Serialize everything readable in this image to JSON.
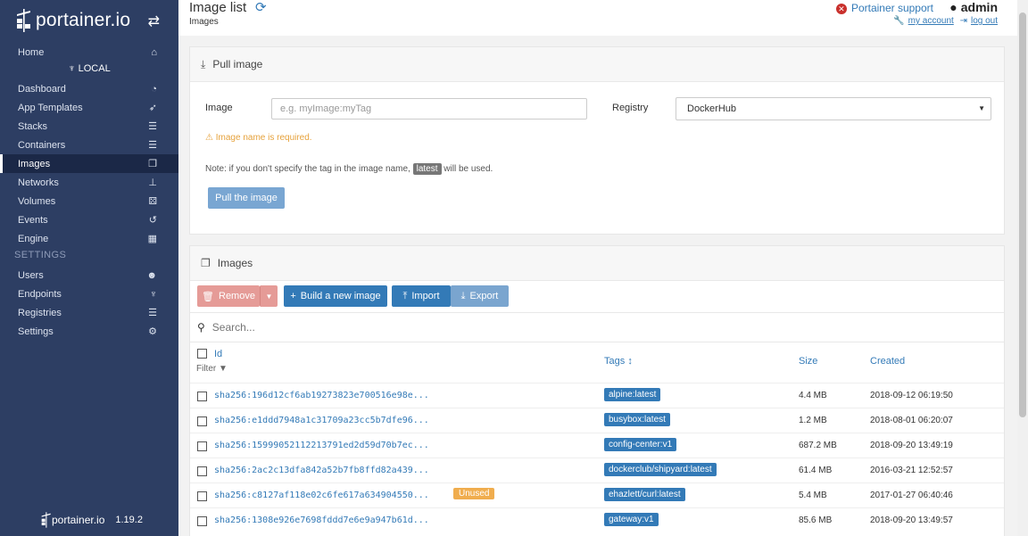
{
  "brand": {
    "name": "portainer.io",
    "logo_icon": "crane-logo-icon",
    "toggle_icon": "swap-arrows-icon"
  },
  "sidebar": {
    "home": {
      "label": "Home",
      "icon": "home-icon"
    },
    "endpoint": "LOCAL",
    "items": [
      {
        "label": "Dashboard",
        "icon": "dashboard-icon"
      },
      {
        "label": "App Templates",
        "icon": "rocket-icon"
      },
      {
        "label": "Stacks",
        "icon": "list-icon"
      },
      {
        "label": "Containers",
        "icon": "list-icon"
      },
      {
        "label": "Images",
        "icon": "clone-icon",
        "active": true
      },
      {
        "label": "Networks",
        "icon": "sitemap-icon"
      },
      {
        "label": "Volumes",
        "icon": "cubes-icon"
      },
      {
        "label": "Events",
        "icon": "history-icon"
      },
      {
        "label": "Engine",
        "icon": "th-icon"
      }
    ],
    "settings_heading": "SETTINGS",
    "settings_items": [
      {
        "label": "Users",
        "icon": "users-icon"
      },
      {
        "label": "Endpoints",
        "icon": "plug-icon"
      },
      {
        "label": "Registries",
        "icon": "database-icon"
      },
      {
        "label": "Settings",
        "icon": "cogs-icon"
      }
    ],
    "footer": {
      "name": "portainer.io",
      "version": "1.19.2"
    }
  },
  "header": {
    "title": "Image list",
    "breadcrumb": "Images",
    "support": "Portainer support",
    "user": "admin",
    "my_account": "my account",
    "log_out": "log out"
  },
  "pull": {
    "heading": "Pull image",
    "image_label": "Image",
    "image_placeholder": "e.g. myImage:myTag",
    "registry_label": "Registry",
    "registry_value": "DockerHub",
    "warning": "Image name is required.",
    "note_prefix": "Note: if you don't specify the tag in the image name,",
    "note_tag": "latest",
    "note_suffix": "will be used.",
    "button": "Pull the image"
  },
  "images": {
    "heading": "Images",
    "buttons": {
      "remove": "Remove",
      "build": "Build a new image",
      "import": "Import",
      "export": "Export"
    },
    "search_placeholder": "Search...",
    "columns": {
      "id": "Id",
      "filter": "Filter",
      "tags": "Tags",
      "size": "Size",
      "created": "Created"
    },
    "rows": [
      {
        "id": "sha256:196d12cf6ab19273823e700516e98e...",
        "tag": "alpine:latest",
        "size": "4.4 MB",
        "created": "2018-09-12 06:19:50"
      },
      {
        "id": "sha256:e1ddd7948a1c31709a23cc5b7dfe96...",
        "tag": "busybox:latest",
        "size": "1.2 MB",
        "created": "2018-08-01 06:20:07"
      },
      {
        "id": "sha256:15999052112213791ed2d59d70b7ec...",
        "tag": "config-center:v1",
        "size": "687.2 MB",
        "created": "2018-09-20 13:49:19"
      },
      {
        "id": "sha256:2ac2c13dfa842a52b7fb8ffd82a439...",
        "tag": "dockerclub/shipyard:latest",
        "size": "61.4 MB",
        "created": "2016-03-21 12:52:57"
      },
      {
        "id": "sha256:c8127af118e02c6fe617a634904550...",
        "unused": "Unused",
        "tag": "ehazlett/curl:latest",
        "size": "5.4 MB",
        "created": "2017-01-27 06:40:46"
      },
      {
        "id": "sha256:1308e926e7698fddd7e6e9a947b61d...",
        "tag": "gateway:v1",
        "size": "85.6 MB",
        "created": "2018-09-20 13:49:57"
      }
    ]
  }
}
